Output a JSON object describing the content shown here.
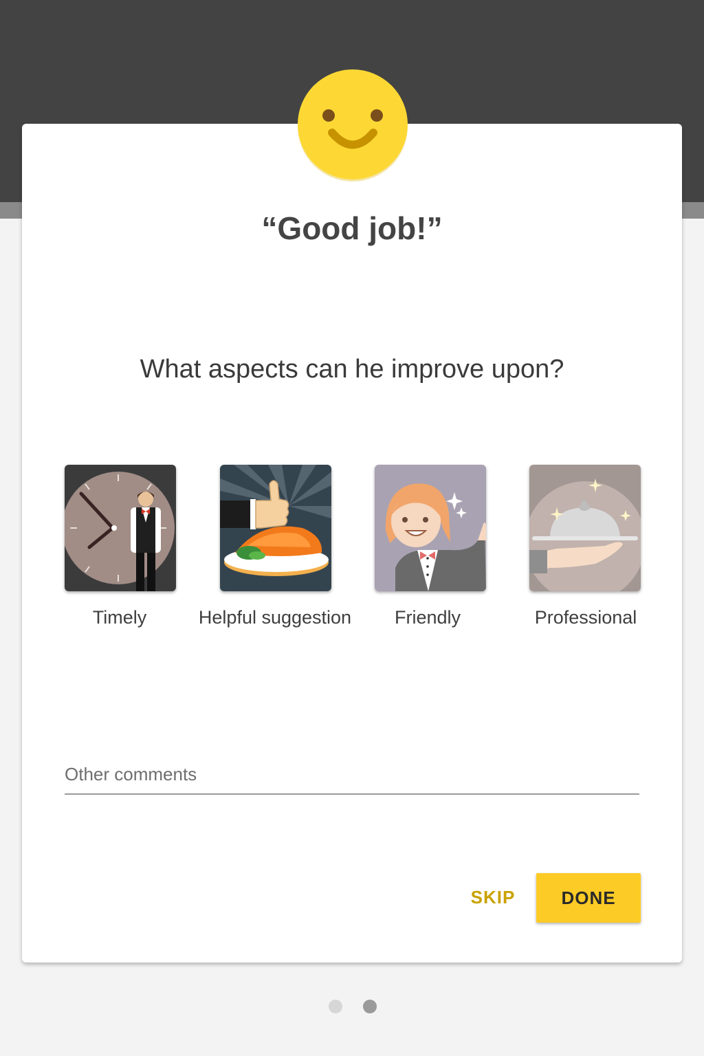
{
  "header": {
    "mood_icon": "smiley-face-icon",
    "title": "“Good job!”"
  },
  "question": "What aspects can he improve upon?",
  "aspects": [
    {
      "label": "Timely",
      "icon": "clock-waiter-icon"
    },
    {
      "label": "Helpful suggestion",
      "icon": "thumbs-up-food-icon"
    },
    {
      "label": "Friendly",
      "icon": "smiling-waitress-icon"
    },
    {
      "label": "Professional",
      "icon": "serving-cloche-icon"
    }
  ],
  "comments": {
    "placeholder": "Other comments",
    "value": ""
  },
  "actions": {
    "skip_label": "SKIP",
    "done_label": "DONE"
  },
  "pager": {
    "total": 2,
    "current": 2
  },
  "colors": {
    "accent": "#fdcb25",
    "skip_text": "#c9a200",
    "header_bg": "#434343",
    "smiley": "#fdd835"
  }
}
